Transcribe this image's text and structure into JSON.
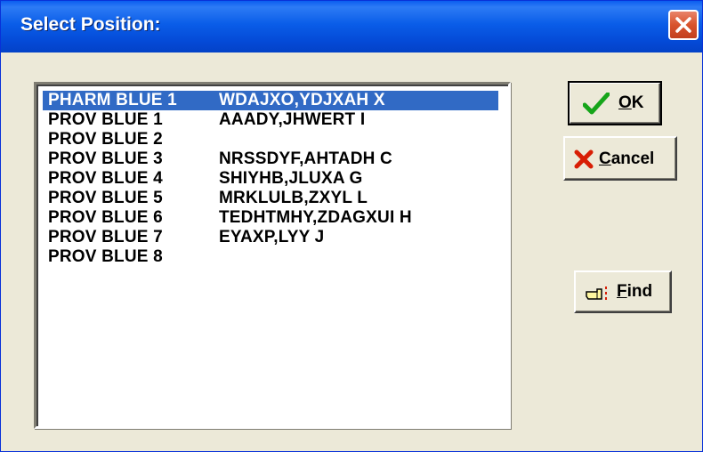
{
  "window": {
    "title": "Select Position:"
  },
  "icons": {
    "close": "close-icon",
    "ok": "checkmark-icon",
    "cancel": "red-x-icon",
    "find": "pointing-hand-icon"
  },
  "colors": {
    "title_bar": "#0a5de8",
    "selection": "#316ac5",
    "close_button": "#d8532c",
    "ok_check": "#16a51a",
    "cancel_x": "#d81e05"
  },
  "list": {
    "selected_index": 0,
    "rows": [
      {
        "position": "PHARM BLUE 1",
        "name": "WDAJXO,YDJXAH X"
      },
      {
        "position": "PROV BLUE 1",
        "name": "AAADY,JHWERT I"
      },
      {
        "position": "PROV BLUE 2",
        "name": ""
      },
      {
        "position": "PROV BLUE 3",
        "name": "NRSSDYF,AHTADH C"
      },
      {
        "position": "PROV BLUE 4",
        "name": "SHIYHB,JLUXA G"
      },
      {
        "position": "PROV BLUE 5",
        "name": "MRKLULB,ZXYL L"
      },
      {
        "position": "PROV BLUE 6",
        "name": "TEDHTMHY,ZDAGXUI H"
      },
      {
        "position": "PROV BLUE 7",
        "name": "EYAXP,LYY J"
      },
      {
        "position": "PROV BLUE 8",
        "name": ""
      }
    ]
  },
  "buttons": {
    "ok": {
      "mnemonic": "O",
      "rest": "K"
    },
    "cancel": {
      "mnemonic": "C",
      "rest": "ancel"
    },
    "find": {
      "mnemonic": "F",
      "rest": "ind"
    }
  }
}
